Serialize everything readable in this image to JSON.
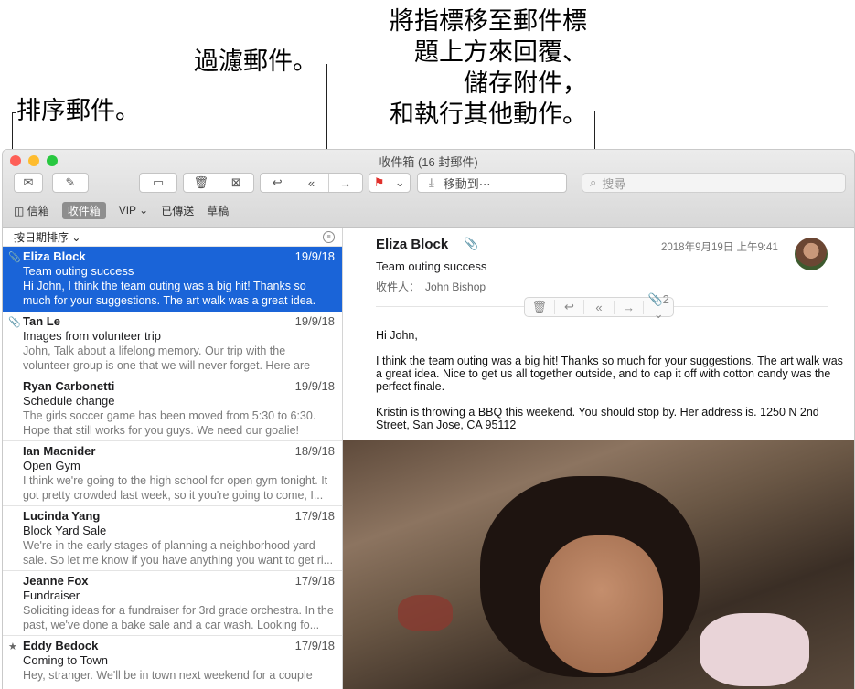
{
  "callouts": {
    "sort": "排序郵件。",
    "filter": "過濾郵件。",
    "hover_line1": "將指標移至郵件標",
    "hover_line2": "題上方來回覆、",
    "hover_line3": "儲存附件，",
    "hover_line4": "和執行其他動作。"
  },
  "window": {
    "title": "收件箱 (16 封郵件)",
    "move_label": "移動到⋯",
    "search_placeholder": "搜尋"
  },
  "favorites": {
    "mailboxes": "信箱",
    "inbox": "收件箱",
    "vip": "VIP ⌄",
    "sent": "已傳送",
    "drafts": "草稿"
  },
  "list": {
    "sort_label": "按日期排序 ⌄",
    "messages": [
      {
        "sender": "Eliza Block",
        "date": "19/9/18",
        "subject": "Team outing success",
        "preview": "Hi John, I think the team outing was a big hit! Thanks so much for your suggestions. The art walk was a great idea. N...",
        "mark": "📎"
      },
      {
        "sender": "Tan Le",
        "date": "19/9/18",
        "subject": "Images from volunteer trip",
        "preview": "John, Talk about a lifelong memory. Our trip with the volunteer group is one that we will never forget. Here are so...",
        "mark": "📎"
      },
      {
        "sender": "Ryan Carbonetti",
        "date": "19/9/18",
        "subject": "Schedule change",
        "preview": "The girls soccer game has been moved from 5:30 to 6:30. Hope that still works for you guys. We need our goalie!",
        "mark": ""
      },
      {
        "sender": "Ian Macnider",
        "date": "18/9/18",
        "subject": "Open Gym",
        "preview": "I think we're going to the high school for open gym tonight. It got pretty crowded last week, so it you're going to come, I...",
        "mark": ""
      },
      {
        "sender": "Lucinda Yang",
        "date": "17/9/18",
        "subject": "Block Yard Sale",
        "preview": "We're in the early stages of planning a neighborhood yard sale. So let me know if you have anything you want to get ri...",
        "mark": ""
      },
      {
        "sender": "Jeanne Fox",
        "date": "17/9/18",
        "subject": "Fundraiser",
        "preview": "Soliciting ideas for a fundraiser for 3rd grade orchestra. In the past, we've done a bake sale and a car wash. Looking fo...",
        "mark": ""
      },
      {
        "sender": "Eddy Bedock",
        "date": "17/9/18",
        "subject": "Coming to Town",
        "preview": "Hey, stranger. We'll be in town next weekend for a couple",
        "mark": "★"
      }
    ]
  },
  "reader": {
    "sender": "Eliza Block",
    "date": "2018年9月19日 上午9:41",
    "subject": "Team outing success",
    "to_label": "收件人：",
    "to_name": "John Bishop",
    "attachment_count": "2 ⌄",
    "greeting": "Hi John,",
    "para1": "I think the team outing was a big hit! Thanks so much for your suggestions. The art walk was a great idea. Nice to get us all together outside, and to cap it off with cotton candy was the perfect finale.",
    "para2": "Kristin is throwing a BBQ this weekend. You should stop by. Her address is. 1250 N 2nd Street, San Jose, CA 95112"
  },
  "colors": {
    "selection": "#1a64d8",
    "close": "#fe5f57",
    "minimize": "#febc2e",
    "zoom": "#28c840",
    "flag": "#e0302b"
  }
}
